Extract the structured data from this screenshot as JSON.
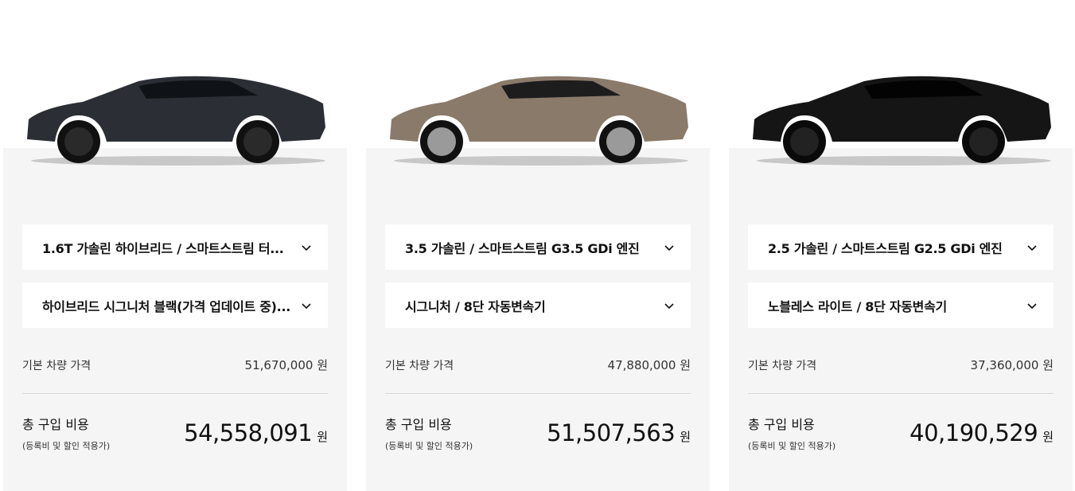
{
  "cards": [
    {
      "color": "#2b2f35",
      "engine": "1.6T 가솔린 하이브리드 / 스마트스트림 터...",
      "trim": "하이브리드 시그니처 블랙(가격 업데이트 중)...",
      "base_label": "기본 차량 가격",
      "base_price": "51,670,000 원",
      "total_label": "총 구입 비용",
      "total_sub": "(등록비 및 할인 적용가)",
      "total_price": "54,558,091",
      "won": "원"
    },
    {
      "color": "#8a7a6a",
      "engine": "3.5 가솔린 / 스마트스트림 G3.5 GDi 엔진",
      "trim": "시그니처 / 8단 자동변속기",
      "base_label": "기본 차량 가격",
      "base_price": "47,880,000 원",
      "total_label": "총 구입 비용",
      "total_sub": "(등록비 및 할인 적용가)",
      "total_price": "51,507,563",
      "won": "원"
    },
    {
      "color": "#151515",
      "engine": "2.5 가솔린 / 스마트스트림 G2.5 GDi 엔진",
      "trim": "노블레스 라이트 / 8단 자동변속기",
      "base_label": "기본 차량 가격",
      "base_price": "37,360,000 원",
      "total_label": "총 구입 비용",
      "total_sub": "(등록비 및 할인 적용가)",
      "total_price": "40,190,529",
      "won": "원"
    }
  ]
}
